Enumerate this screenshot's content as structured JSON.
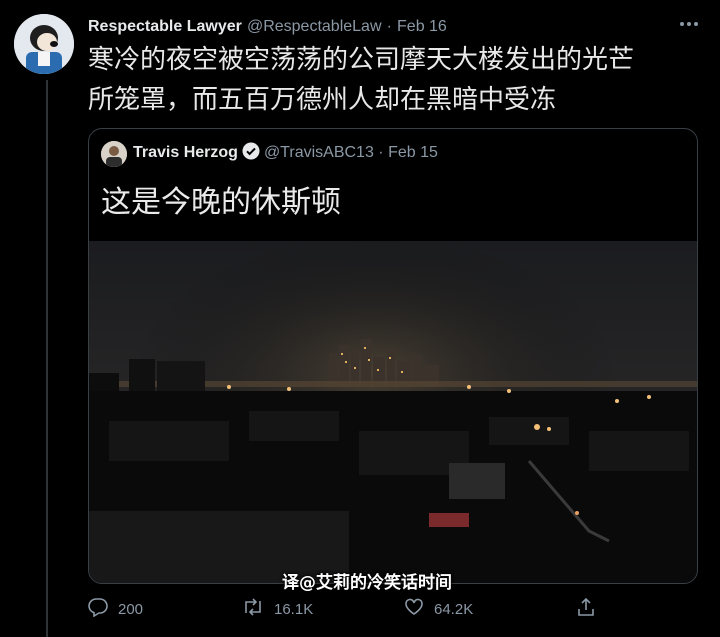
{
  "tweet": {
    "author_name": "Respectable Lawyer",
    "handle": "@RespectableLaw",
    "date": "Feb 16",
    "text_line1": "寒冷的夜空被空荡荡的公司摩天大楼发出的光芒",
    "text_line2": "所笼罩，而五百万德州人却在黑暗中受冻"
  },
  "quoted": {
    "author_name": "Travis Herzog",
    "handle": "@TravisABC13",
    "date": "Feb 15",
    "text": "这是今晚的休斯顿"
  },
  "watermark": "译@艾莉的冷笑话时间",
  "actions": {
    "reply_count": "200",
    "retweet_count": "16.1K",
    "like_count": "64.2K"
  },
  "icons": [
    "more-icon",
    "verified-icon",
    "reply-icon",
    "retweet-icon",
    "like-icon",
    "share-icon"
  ],
  "colors": {
    "background": "#000000",
    "muted": "#8b98a5",
    "verified": "#1d9bf0"
  }
}
